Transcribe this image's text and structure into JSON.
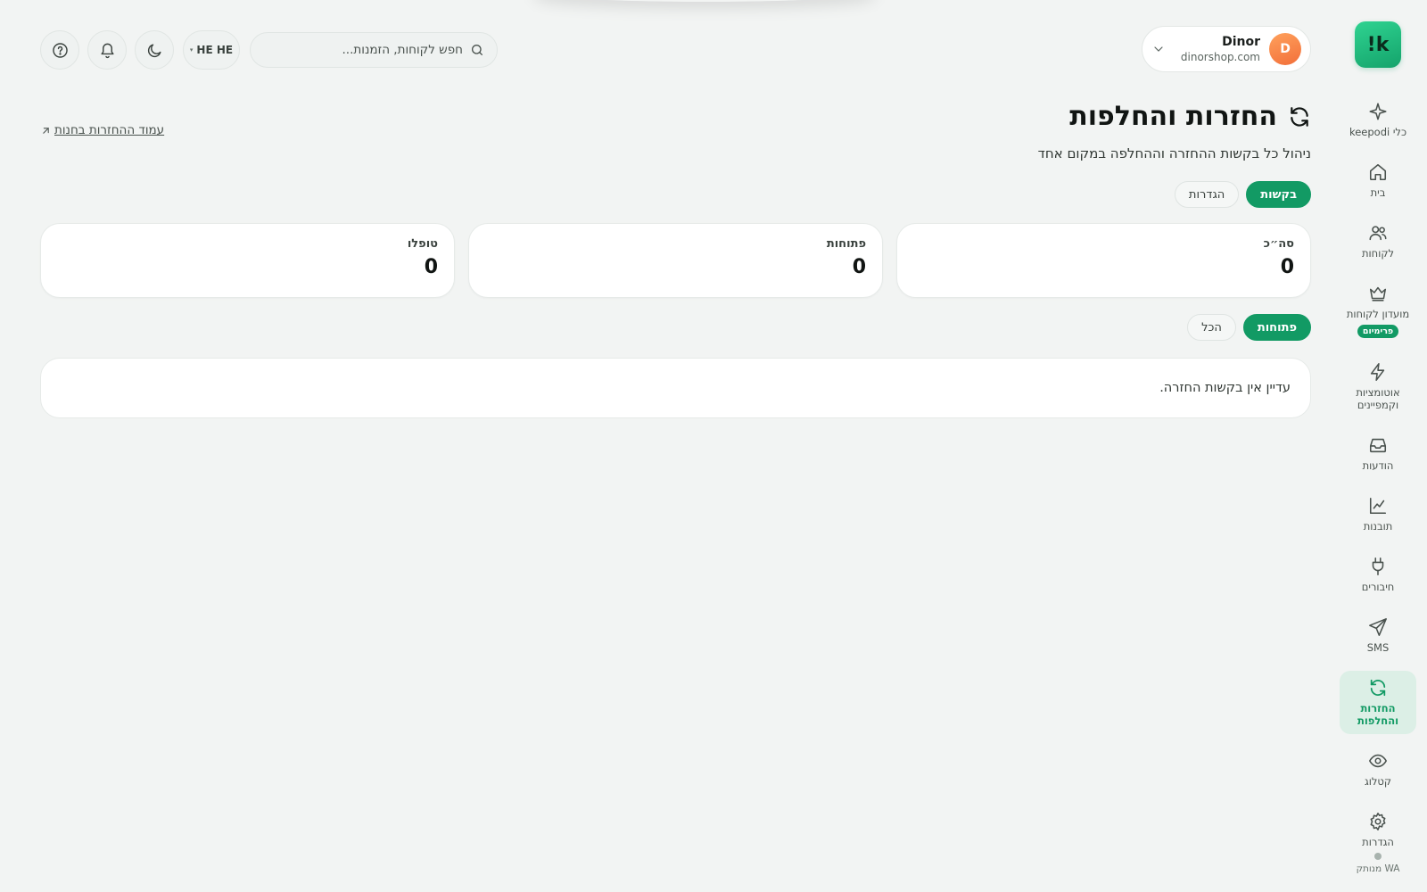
{
  "sidebar": {
    "logo": "!k",
    "items": [
      {
        "label": "כלי keepodi",
        "icon": "sparkle-icon"
      },
      {
        "label": "בית",
        "icon": "home-icon"
      },
      {
        "label": "לקוחות",
        "icon": "users-icon"
      },
      {
        "label": "מועדון לקוחות",
        "icon": "crown-icon",
        "badge": "פרימיום"
      },
      {
        "label": "אוטומציות\nוקמפיינים",
        "icon": "lightning-icon"
      },
      {
        "label": "הודעות",
        "icon": "inbox-icon"
      },
      {
        "label": "תובנות",
        "icon": "chart-icon"
      },
      {
        "label": "חיבורים",
        "icon": "plug-icon"
      },
      {
        "label": "SMS",
        "icon": "send-icon"
      },
      {
        "label": "החזרות\nוהחלפות",
        "icon": "refresh-icon",
        "active": true
      },
      {
        "label": "קטלוג",
        "icon": "eye-icon"
      },
      {
        "label": "הגדרות",
        "icon": "gear-icon"
      }
    ],
    "wa_status": "WA מנותק"
  },
  "header": {
    "store": {
      "name": "Dinor",
      "domain": "dinorshop.com",
      "avatar_letter": "D"
    },
    "search": {
      "placeholder": "חפש לקוחות, הזמנות..."
    },
    "language": "HE HE"
  },
  "main": {
    "title": "החזרות והחלפות",
    "subtitle": "ניהול כל בקשות ההחזרה וההחלפה במקום אחד",
    "store_link": "עמוד ההחזרות בחנות",
    "tabs": [
      {
        "label": "בקשות",
        "active": true
      },
      {
        "label": "הגדרות",
        "active": false
      }
    ],
    "stats": [
      {
        "label": "סה״כ",
        "value": "0"
      },
      {
        "label": "פתוחות",
        "value": "0"
      },
      {
        "label": "טופלו",
        "value": "0"
      }
    ],
    "filters": [
      {
        "label": "פתוחות",
        "active": true
      },
      {
        "label": "הכל",
        "active": false
      }
    ],
    "empty_message": "עדיין אין בקשות החזרה."
  },
  "colors": {
    "accent": "#129a64",
    "background": "#f2f4f3",
    "active_nav_bg": "#dcefe6"
  }
}
